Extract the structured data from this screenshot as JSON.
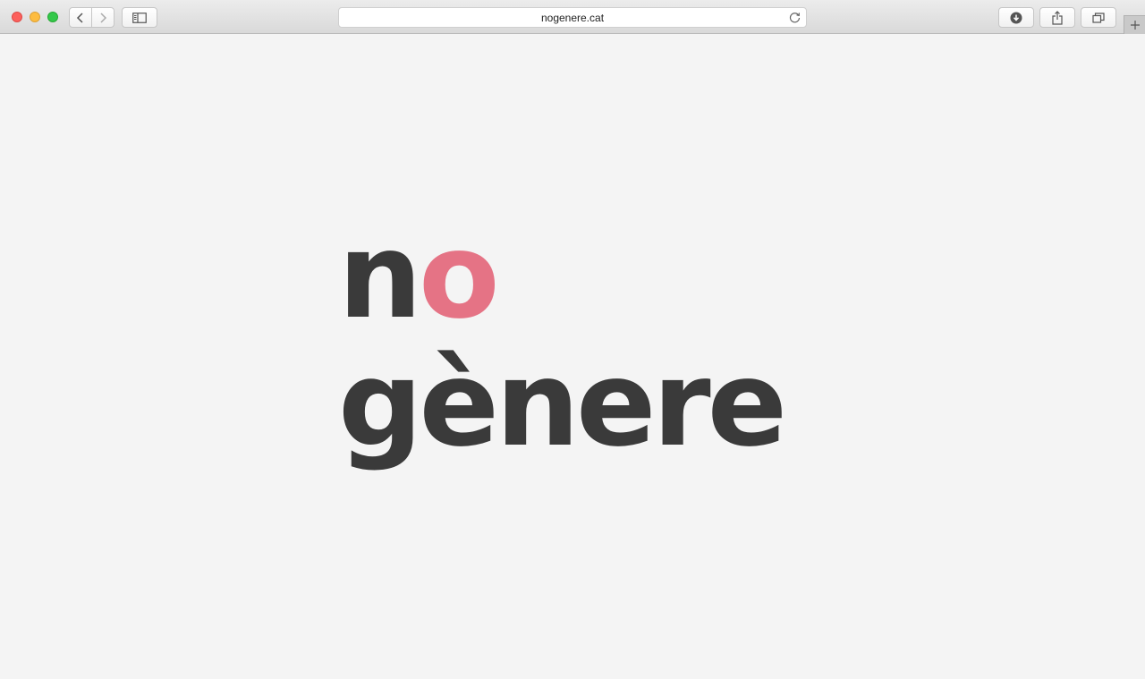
{
  "browser": {
    "address": "nogenere.cat",
    "icons": {
      "back": "chevron-left-icon",
      "forward": "chevron-right-icon",
      "sidebar": "sidebar-icon",
      "reload": "reload-icon",
      "download": "download-icon",
      "share": "share-icon",
      "tabs": "tabs-icon",
      "new_tab": "plus-icon"
    }
  },
  "page": {
    "logo": {
      "line1_part1": "n",
      "line1_accent": "o",
      "line2": "gènere"
    },
    "colors": {
      "text": "#3a3a3a",
      "accent": "#e57385",
      "background": "#f4f4f4"
    }
  }
}
